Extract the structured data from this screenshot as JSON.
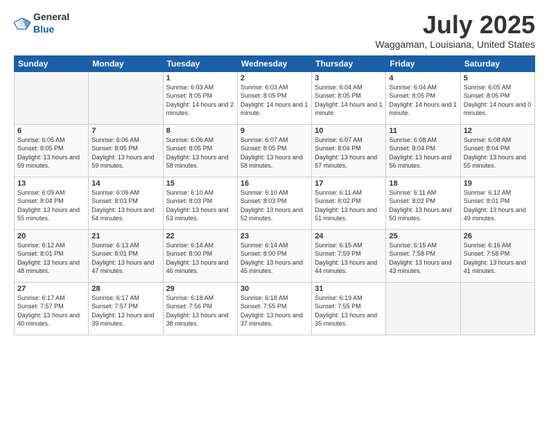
{
  "logo": {
    "general": "General",
    "blue": "Blue"
  },
  "title": {
    "month_year": "July 2025",
    "location": "Waggaman, Louisiana, United States"
  },
  "days_of_week": [
    "Sunday",
    "Monday",
    "Tuesday",
    "Wednesday",
    "Thursday",
    "Friday",
    "Saturday"
  ],
  "weeks": [
    [
      {
        "day": "",
        "empty": true
      },
      {
        "day": "",
        "empty": true
      },
      {
        "day": "1",
        "sunrise": "6:03 AM",
        "sunset": "8:05 PM",
        "daylight": "14 hours and 2 minutes."
      },
      {
        "day": "2",
        "sunrise": "6:03 AM",
        "sunset": "8:05 PM",
        "daylight": "14 hours and 1 minute."
      },
      {
        "day": "3",
        "sunrise": "6:04 AM",
        "sunset": "8:05 PM",
        "daylight": "14 hours and 1 minute."
      },
      {
        "day": "4",
        "sunrise": "6:04 AM",
        "sunset": "8:05 PM",
        "daylight": "14 hours and 1 minute."
      },
      {
        "day": "5",
        "sunrise": "6:05 AM",
        "sunset": "8:05 PM",
        "daylight": "14 hours and 0 minutes."
      }
    ],
    [
      {
        "day": "6",
        "sunrise": "6:05 AM",
        "sunset": "8:05 PM",
        "daylight": "13 hours and 59 minutes."
      },
      {
        "day": "7",
        "sunrise": "6:06 AM",
        "sunset": "8:05 PM",
        "daylight": "13 hours and 59 minutes."
      },
      {
        "day": "8",
        "sunrise": "6:06 AM",
        "sunset": "8:05 PM",
        "daylight": "13 hours and 58 minutes."
      },
      {
        "day": "9",
        "sunrise": "6:07 AM",
        "sunset": "8:05 PM",
        "daylight": "13 hours and 58 minutes."
      },
      {
        "day": "10",
        "sunrise": "6:07 AM",
        "sunset": "8:04 PM",
        "daylight": "13 hours and 57 minutes."
      },
      {
        "day": "11",
        "sunrise": "6:08 AM",
        "sunset": "8:04 PM",
        "daylight": "13 hours and 56 minutes."
      },
      {
        "day": "12",
        "sunrise": "6:08 AM",
        "sunset": "8:04 PM",
        "daylight": "13 hours and 55 minutes."
      }
    ],
    [
      {
        "day": "13",
        "sunrise": "6:09 AM",
        "sunset": "8:04 PM",
        "daylight": "13 hours and 55 minutes."
      },
      {
        "day": "14",
        "sunrise": "6:09 AM",
        "sunset": "8:03 PM",
        "daylight": "13 hours and 54 minutes."
      },
      {
        "day": "15",
        "sunrise": "6:10 AM",
        "sunset": "8:03 PM",
        "daylight": "13 hours and 53 minutes."
      },
      {
        "day": "16",
        "sunrise": "6:10 AM",
        "sunset": "8:03 PM",
        "daylight": "13 hours and 52 minutes."
      },
      {
        "day": "17",
        "sunrise": "6:11 AM",
        "sunset": "8:02 PM",
        "daylight": "13 hours and 51 minutes."
      },
      {
        "day": "18",
        "sunrise": "6:11 AM",
        "sunset": "8:02 PM",
        "daylight": "13 hours and 50 minutes."
      },
      {
        "day": "19",
        "sunrise": "6:12 AM",
        "sunset": "8:01 PM",
        "daylight": "13 hours and 49 minutes."
      }
    ],
    [
      {
        "day": "20",
        "sunrise": "6:12 AM",
        "sunset": "8:01 PM",
        "daylight": "13 hours and 48 minutes."
      },
      {
        "day": "21",
        "sunrise": "6:13 AM",
        "sunset": "8:01 PM",
        "daylight": "13 hours and 47 minutes."
      },
      {
        "day": "22",
        "sunrise": "6:14 AM",
        "sunset": "8:00 PM",
        "daylight": "13 hours and 46 minutes."
      },
      {
        "day": "23",
        "sunrise": "6:14 AM",
        "sunset": "8:00 PM",
        "daylight": "13 hours and 45 minutes."
      },
      {
        "day": "24",
        "sunrise": "6:15 AM",
        "sunset": "7:59 PM",
        "daylight": "13 hours and 44 minutes."
      },
      {
        "day": "25",
        "sunrise": "6:15 AM",
        "sunset": "7:58 PM",
        "daylight": "13 hours and 43 minutes."
      },
      {
        "day": "26",
        "sunrise": "6:16 AM",
        "sunset": "7:58 PM",
        "daylight": "13 hours and 41 minutes."
      }
    ],
    [
      {
        "day": "27",
        "sunrise": "6:17 AM",
        "sunset": "7:57 PM",
        "daylight": "13 hours and 40 minutes."
      },
      {
        "day": "28",
        "sunrise": "6:17 AM",
        "sunset": "7:57 PM",
        "daylight": "13 hours and 39 minutes."
      },
      {
        "day": "29",
        "sunrise": "6:18 AM",
        "sunset": "7:56 PM",
        "daylight": "13 hours and 38 minutes."
      },
      {
        "day": "30",
        "sunrise": "6:18 AM",
        "sunset": "7:55 PM",
        "daylight": "13 hours and 37 minutes."
      },
      {
        "day": "31",
        "sunrise": "6:19 AM",
        "sunset": "7:55 PM",
        "daylight": "13 hours and 35 minutes."
      },
      {
        "day": "",
        "empty": true
      },
      {
        "day": "",
        "empty": true
      }
    ]
  ]
}
